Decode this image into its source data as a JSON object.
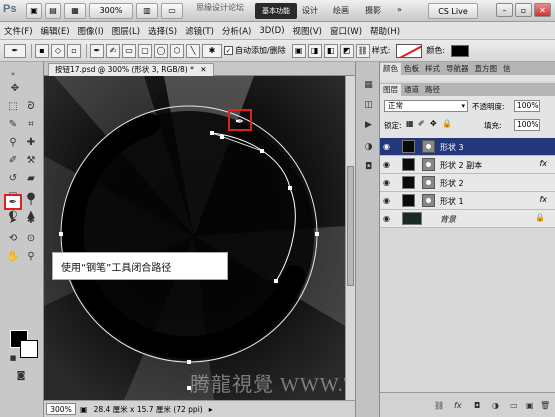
{
  "titlebar": {
    "logo": "Ps",
    "zoom": "300%",
    "workspace_active": "基本功能",
    "workspace_items": [
      "设计",
      "绘画",
      "摄影"
    ],
    "cslive": "CS Live",
    "overlay_brand": "思缘设计论坛"
  },
  "menu": [
    "文件(F)",
    "编辑(E)",
    "图像(I)",
    "图层(L)",
    "选择(S)",
    "滤镜(T)",
    "分析(A)",
    "3D(D)",
    "视图(V)",
    "窗口(W)",
    "帮助(H)"
  ],
  "options": {
    "auto_add_delete": "自动添加/删除",
    "style_label": "样式:",
    "color_label": "颜色:",
    "color_value": "#000000"
  },
  "document": {
    "tab_title": "按钮17.psd @ 300% (形状 3, RGB/8) *",
    "status_zoom": "300%",
    "status_info": "28.4 厘米 x 15.7 厘米 (72 ppi)"
  },
  "tooltip": "使用“钢笔”工具闭合路径",
  "watermark": "腾龍視覺 WWW.TLVI.NET",
  "panels": {
    "tabs_top": [
      "颜色",
      "色板",
      "样式",
      "导航器",
      "直方图",
      "信"
    ],
    "tabs_layers": [
      "图层",
      "通道",
      "路径"
    ],
    "blend_mode": "正常",
    "opacity_label": "不透明度:",
    "opacity_value": "100%",
    "lock_label": "锁定:",
    "fill_label": "填充:",
    "fill_value": "100%",
    "layers": [
      {
        "name": "形状 3",
        "fx": ""
      },
      {
        "name": "形状 2 副本",
        "fx": "fx"
      },
      {
        "name": "形状 2",
        "fx": ""
      },
      {
        "name": "形状 1",
        "fx": "fx"
      },
      {
        "name": "背景",
        "fx": ""
      }
    ]
  }
}
